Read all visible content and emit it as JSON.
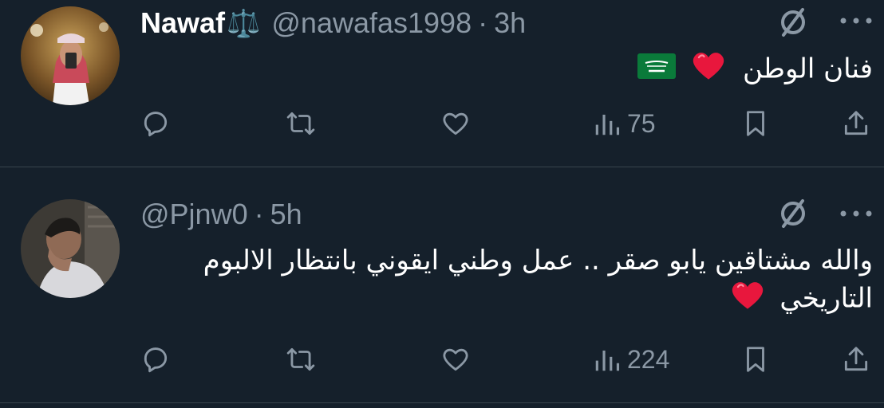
{
  "tweets": [
    {
      "name": "Nawaf",
      "badge": "⚖️",
      "handle": "@nawafas1998",
      "dot": "·",
      "time": "3h",
      "text": "فنان الوطن",
      "views": "75"
    },
    {
      "handle": "@Pjnw0",
      "dot": "·",
      "time": "5h",
      "text_line1": "والله مشتاقين يابو صقر .. عمل وطني ايقوني بانتظار الالبوم",
      "text_line2": "التاريخي",
      "views": "224"
    }
  ],
  "icons": {
    "grok": "grok-icon",
    "more": "more-icon",
    "reply": "reply-icon",
    "retweet": "retweet-icon",
    "like": "like-icon",
    "views": "views-icon",
    "bookmark": "bookmark-icon",
    "share": "share-icon",
    "heart_emoji": "red-heart-emoji",
    "flag_emoji": "saudi-flag-emoji"
  },
  "colors": {
    "background": "#15202b",
    "secondary_text": "#8b98a5",
    "divider": "#38444d",
    "heart": "#e8173d",
    "flag": "#0a7a3a"
  }
}
